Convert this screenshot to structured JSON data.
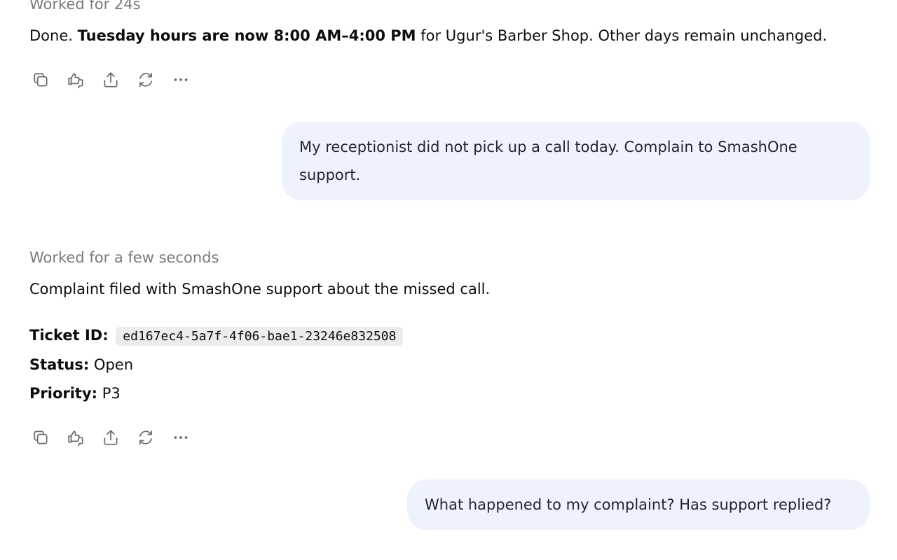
{
  "messages": {
    "first_reply": {
      "worked": "Worked for 24s",
      "prefix": "Done. ",
      "bold": "Tuesday hours are now 8:00 AM–4:00 PM",
      "suffix": " for Ugur's Barber Shop. Other days remain unchanged."
    },
    "user_message_1": {
      "text": "My receptionist did not pick up a call today. Complain to SmashOne support."
    },
    "second_reply": {
      "worked": "Worked for a few seconds",
      "summary": "Complaint filed with SmashOne support about the missed call.",
      "ticket_label": "Ticket ID:",
      "ticket_id": "ed167ec4-5a7f-4f06-bae1-23246e832508",
      "status_label": "Status:",
      "status_value": " Open",
      "priority_label": "Priority:",
      "priority_value": " P3"
    },
    "user_message_2": {
      "text": "What happened to my complaint? Has support replied?"
    }
  },
  "action_icons": [
    "copy-icon",
    "thumbs-feedback-icon",
    "share-icon",
    "regenerate-icon",
    "more-icon"
  ],
  "colors": {
    "user_bubble": "#eef2fd",
    "muted_text": "#7a7a7a",
    "icon": "#6b6b6b",
    "code_bg": "#ececec"
  }
}
